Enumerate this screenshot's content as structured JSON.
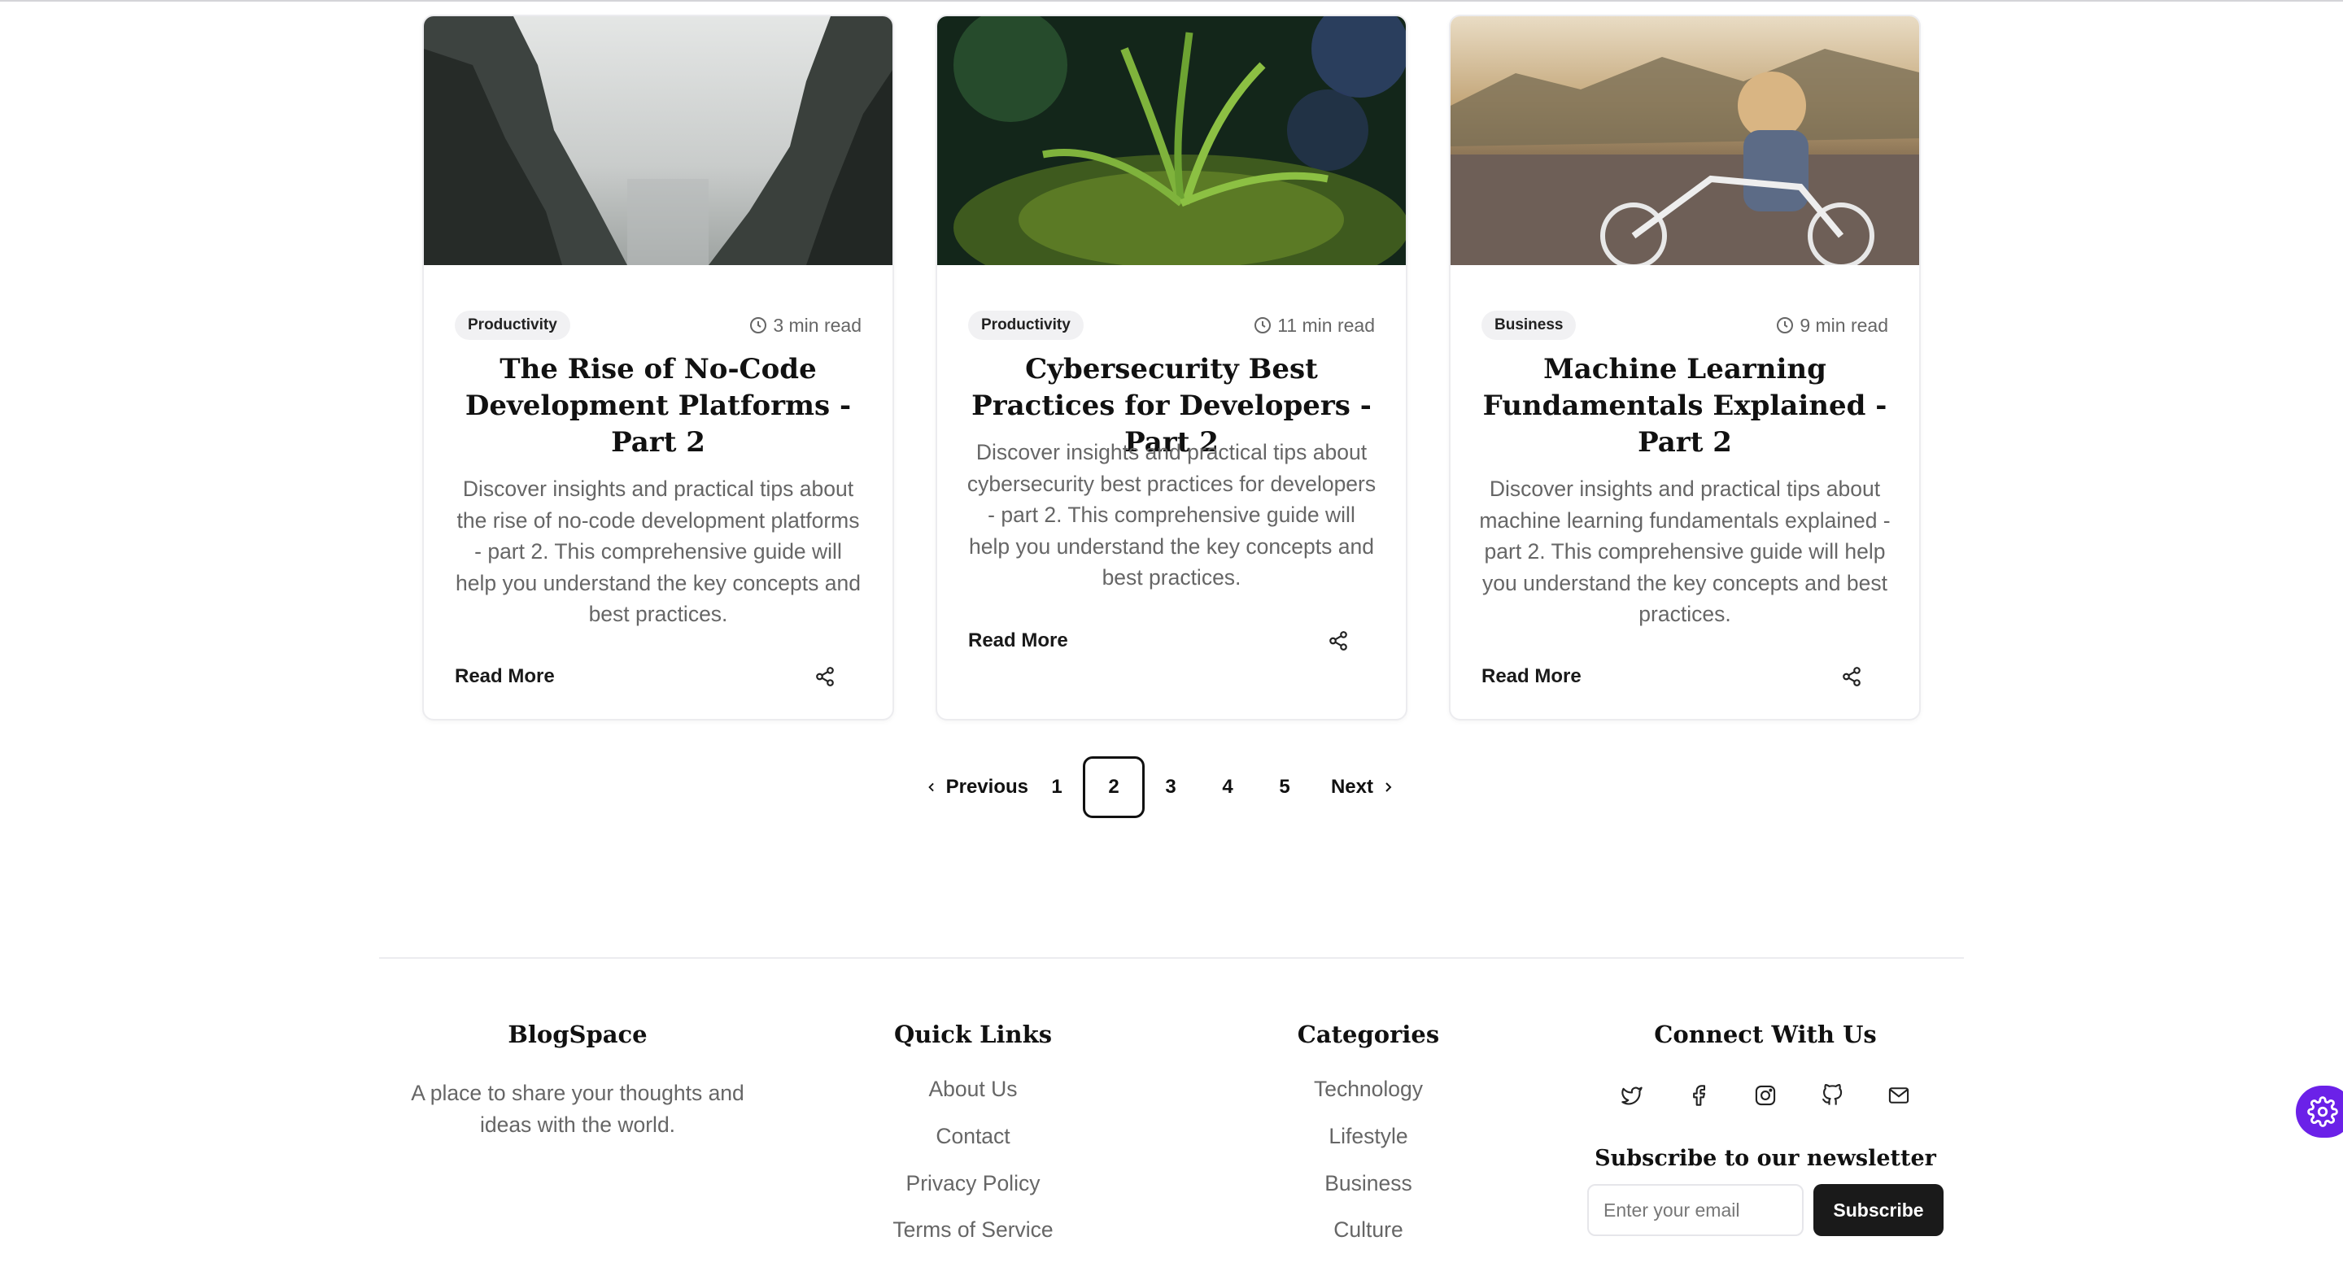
{
  "posts": [
    {
      "category": "Productivity",
      "read_time": "3 min read",
      "title": "The Rise of No-Code Development Platforms - Part 2",
      "description": "Discover insights and practical tips about the rise of no-code development platforms - part 2. This comprehensive guide will help you understand the key concepts and best practices.",
      "read_more": "Read More",
      "image_icon": "misty-canyon-photo"
    },
    {
      "category": "Productivity",
      "read_time": "11 min read",
      "title": "Cybersecurity Best Practices for Developers - Part 2",
      "description": "Discover insights and practical tips about cybersecurity best practices for developers - part 2. This comprehensive guide will help you understand the key concepts and best practices.",
      "read_more": "Read More",
      "image_icon": "forest-plant-photo"
    },
    {
      "category": "Business",
      "read_time": "9 min read",
      "title": "Machine Learning Fundamentals Explained - Part 2",
      "description": "Discover insights and practical tips about machine learning fundamentals explained - part 2. This comprehensive guide will help you understand the key concepts and best practices.",
      "read_more": "Read More",
      "image_icon": "woman-on-bicycle-photo"
    }
  ],
  "pagination": {
    "previous": "Previous",
    "next": "Next",
    "pages": [
      "1",
      "2",
      "3",
      "4",
      "5"
    ],
    "current": "2"
  },
  "footer": {
    "brand": {
      "name": "BlogSpace",
      "tagline": "A place to share your thoughts and ideas with the world."
    },
    "quick_links": {
      "heading": "Quick Links",
      "items": [
        "About Us",
        "Contact",
        "Privacy Policy",
        "Terms of Service"
      ]
    },
    "categories": {
      "heading": "Categories",
      "items": [
        "Technology",
        "Lifestyle",
        "Business",
        "Culture"
      ]
    },
    "connect": {
      "heading": "Connect With Us",
      "social_icons": [
        "twitter-icon",
        "facebook-icon",
        "instagram-icon",
        "github-icon",
        "mail-icon"
      ],
      "newsletter_heading": "Subscribe to our newsletter",
      "email_placeholder": "Enter your email",
      "subscribe_label": "Subscribe"
    }
  },
  "colors": {
    "accent_fab": "#6b21e8",
    "primary_button": "#1a1a1a",
    "muted_text": "#666666",
    "badge_bg": "#f1f1f3"
  }
}
